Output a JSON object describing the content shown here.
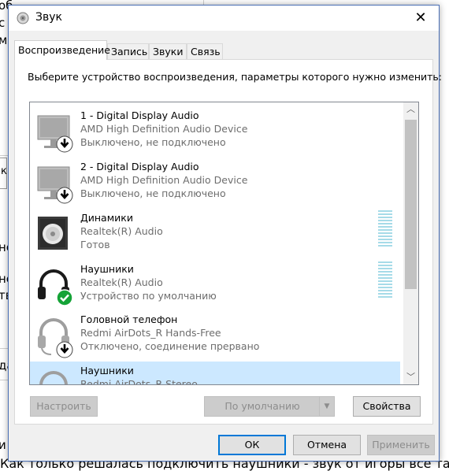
{
  "background": {
    "line1": "об",
    "line2": "с",
    "line3": "м",
    "edge_k": "к",
    "edge_ne": "не",
    "edge_ns": "нс",
    "edge_tv": "тв",
    "edge_da": "да",
    "edge_i": "и",
    "bottom_text": "Как только решалась подключить наушники - звук от игоры все так"
  },
  "window": {
    "title": "Звук",
    "close_label": "✕",
    "tabs": [
      {
        "label": "Воспроизведение",
        "active": true
      },
      {
        "label": "Запись",
        "active": false
      },
      {
        "label": "Звуки",
        "active": false
      },
      {
        "label": "Связь",
        "active": false
      }
    ],
    "instruction": "Выберите устройство воспроизведения, параметры которого нужно изменить:",
    "devices": [
      {
        "name": "1 - Digital Display Audio",
        "desc": "AMD High Definition Audio Device",
        "status": "Выключено, не подключено",
        "icon": "monitor-icon",
        "badge": "down-arrow"
      },
      {
        "name": "2 - Digital Display Audio",
        "desc": "AMD High Definition Audio Device",
        "status": "Выключено, не подключено",
        "icon": "monitor-icon",
        "badge": "down-arrow"
      },
      {
        "name": "Динамики",
        "desc": "Realtek(R) Audio",
        "status": "Готов",
        "icon": "speaker-icon",
        "badge": "none"
      },
      {
        "name": "Наушники",
        "desc": "Realtek(R) Audio",
        "status": "Устройство по умолчанию",
        "icon": "headphones-icon",
        "badge": "check"
      },
      {
        "name": "Головной телефон",
        "desc": "Redmi AirDots_R Hands-Free",
        "status": "Отключено, соединение прервано",
        "icon": "headset-icon",
        "badge": "down-arrow"
      },
      {
        "name": "Наушники",
        "desc": "Redmi AirDots_R Stereo",
        "status": "",
        "icon": "headphones-icon",
        "badge": "none"
      }
    ],
    "buttons": {
      "configure": "Настроить",
      "default": "По умолчанию",
      "properties": "Свойства",
      "ok": "ОК",
      "cancel": "Отмена",
      "apply": "Применить"
    },
    "colors": {
      "accent": "#0078d7",
      "selected_row": "#cce8ff",
      "check_badge": "#15a337",
      "level_meter": "#a6dbe8"
    }
  }
}
